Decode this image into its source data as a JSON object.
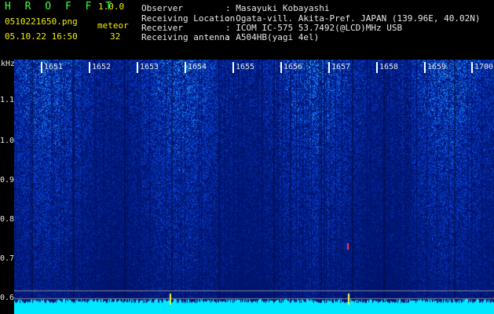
{
  "header": {
    "app_title": "H R O F F T",
    "version": "1.0.0",
    "filename": "0510221650.png",
    "label_type": "meteor",
    "datetime": "05.10.22 16:50",
    "count": "32",
    "info": [
      {
        "key": "Observer",
        "value": ": Masayuki Kobayashi"
      },
      {
        "key": "Receiving Location",
        "value": ": Ogata-vill. Akita-Pref. JAPAN (139.96E, 40.02N)"
      },
      {
        "key": "Receiver",
        "value": ": ICOM IC-575 53.7492(@LCD)MHz USB"
      },
      {
        "key": "Receiving antenna",
        "value": ": A504HB(yagi 4el)"
      }
    ]
  },
  "spectrogram": {
    "y_unit": "kHz",
    "y_ticks": [
      "1.1",
      "1.0",
      "0.9",
      "0.8",
      "0.7",
      "0.6"
    ],
    "x_ticks": [
      "1651",
      "1652",
      "1653",
      "1654",
      "1655",
      "1656",
      "1657",
      "1658",
      "1659",
      "1700"
    ],
    "colors": {
      "background": "#001a6e",
      "noise_low": "#0a2fb0",
      "noise_mid": "#2a7cff",
      "noise_high": "#7dffb0",
      "strong": "#ffff40",
      "baseline": "#00e8ff"
    }
  }
}
